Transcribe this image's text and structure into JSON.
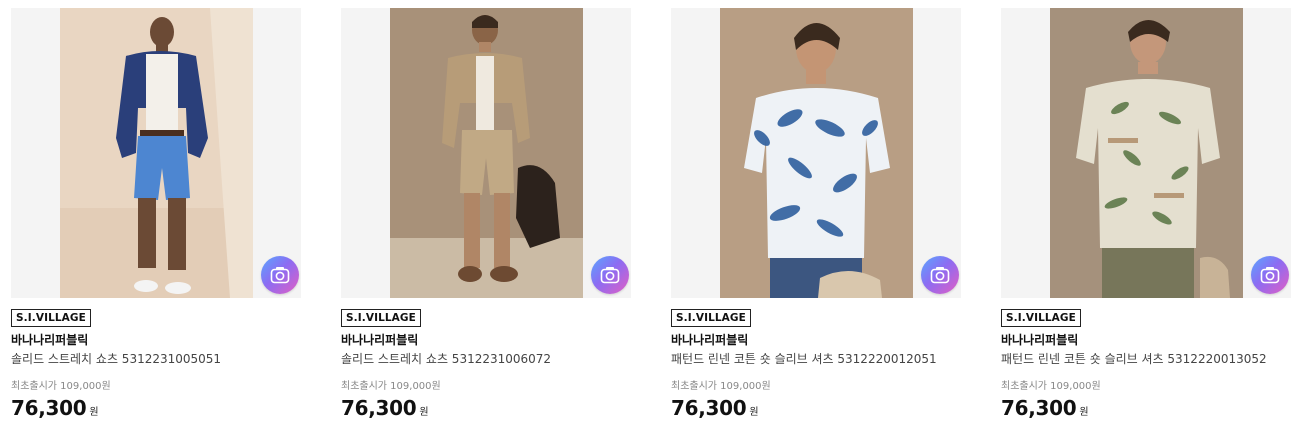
{
  "products": [
    {
      "brand_badge": "S.I.VILLAGE",
      "maker": "바나나리퍼블릭",
      "name": "솔리드 스트레치 쇼츠 5312231005051",
      "original_price": "최초출시가 109,000원",
      "price": "76,300",
      "currency": "원",
      "image": "model-navy-jacket-blue-shorts",
      "icon": "camera-icon"
    },
    {
      "brand_badge": "S.I.VILLAGE",
      "maker": "바나나리퍼블릭",
      "name": "솔리드 스트레치 쇼츠 5312231006072",
      "original_price": "최초출시가 109,000원",
      "price": "76,300",
      "currency": "원",
      "image": "model-khaki-shirt-khaki-shorts",
      "icon": "camera-icon"
    },
    {
      "brand_badge": "S.I.VILLAGE",
      "maker": "바나나리퍼블릭",
      "name": "패턴드 린넨 코튼 숏 슬리브 셔츠 5312220012051",
      "original_price": "최초출시가 109,000원",
      "price": "76,300",
      "currency": "원",
      "image": "model-blue-floral-shirt",
      "icon": "camera-icon"
    },
    {
      "brand_badge": "S.I.VILLAGE",
      "maker": "바나나리퍼블릭",
      "name": "패턴드 린넨 코튼 숏 슬리브 셔츠 5312220013052",
      "original_price": "최초출시가 109,000원",
      "price": "76,300",
      "currency": "원",
      "image": "model-cream-tropical-shirt",
      "icon": "camera-icon"
    }
  ]
}
